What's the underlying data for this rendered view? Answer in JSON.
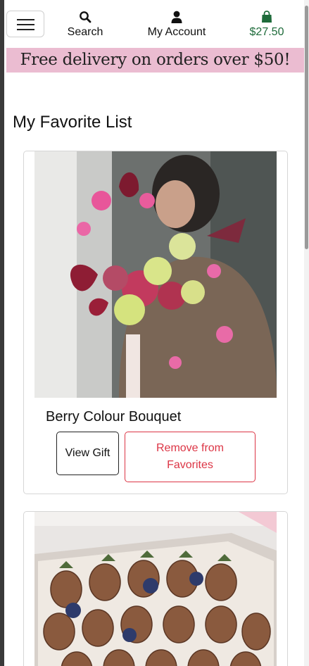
{
  "header": {
    "search_label": "Search",
    "account_label": "My Account",
    "cart_total": "$27.50",
    "menu_icon": "hamburger-menu-icon",
    "search_icon": "search-icon",
    "account_icon": "user-icon",
    "cart_icon": "shopping-bag-icon",
    "accent_color": "#1e6b3a"
  },
  "banner": {
    "text": "Free delivery on orders over $50!",
    "background": "#ebbcd1"
  },
  "page": {
    "title": "My Favorite List"
  },
  "favorites": [
    {
      "name": "Berry Colour Bouquet",
      "view_label": "View Gift",
      "remove_label": "Remove from Favorites",
      "image": "bouquet-photo"
    },
    {
      "name": "",
      "image": "chocolate-strawberries-photo"
    }
  ]
}
